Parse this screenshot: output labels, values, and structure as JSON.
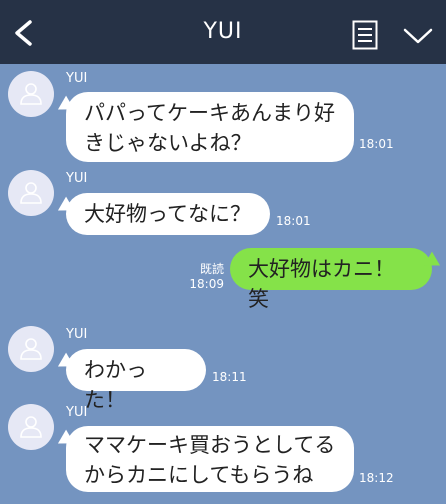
{
  "header": {
    "title": "YUI",
    "back_icon": "chevron-left-icon",
    "menu_icon": "notes-icon",
    "collapse_icon": "chevron-down-icon"
  },
  "messages": [
    {
      "sender": "YUI",
      "text": "パパってケーキあんまり好\nきじゃないよね？",
      "time": "18:01"
    },
    {
      "sender": "YUI",
      "text": "大好物ってなに？",
      "time": "18:01"
    },
    {
      "text": "大好物はカニ！笑",
      "read_label": "既読",
      "time": "18:09"
    },
    {
      "sender": "YUI",
      "text": "わかった！",
      "time": "18:11"
    },
    {
      "sender": "YUI",
      "text": "ママケーキ買おうとしてる\nからカニにしてもらうね",
      "time": "18:12"
    }
  ],
  "colors": {
    "background": "#7494c0",
    "header": "#263246",
    "sent_bubble": "#85e249",
    "received_bubble": "#ffffff"
  }
}
